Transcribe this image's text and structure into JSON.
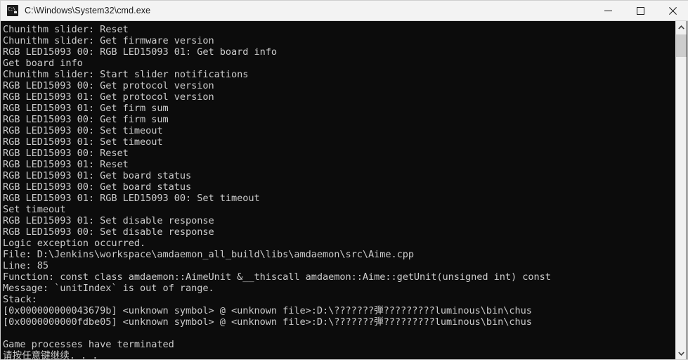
{
  "window": {
    "title": "C:\\Windows\\System32\\cmd.exe",
    "app_icon_label": "C:\\",
    "background_color": "#0c0c0c",
    "text_color": "#cccccc",
    "titlebar_color": "#f3f3f3"
  },
  "window_controls": {
    "minimize_label": "Minimize",
    "maximize_label": "Maximize",
    "close_label": "Close"
  },
  "scrollbar": {
    "up_arrow_label": "Scroll up",
    "down_arrow_label": "Scroll down",
    "thumb_label": "Scroll thumb"
  },
  "console": {
    "lines": [
      "Chunithm slider: Reset",
      "Chunithm slider: Get firmware version",
      "RGB LED15093 00: RGB LED15093 01: Get board info",
      "Get board info",
      "Chunithm slider: Start slider notifications",
      "RGB LED15093 00: Get protocol version",
      "RGB LED15093 01: Get protocol version",
      "RGB LED15093 01: Get firm sum",
      "RGB LED15093 00: Get firm sum",
      "RGB LED15093 00: Set timeout",
      "RGB LED15093 01: Set timeout",
      "RGB LED15093 00: Reset",
      "RGB LED15093 01: Reset",
      "RGB LED15093 01: Get board status",
      "RGB LED15093 00: Get board status",
      "RGB LED15093 01: RGB LED15093 00: Set timeout",
      "Set timeout",
      "RGB LED15093 01: Set disable response",
      "RGB LED15093 00: Set disable response",
      "Logic exception occurred.",
      "File: D:\\Jenkins\\workspace\\amdaemon_all_build\\libs\\amdaemon\\src\\Aime.cpp",
      "Line: 85",
      "Function: const class amdaemon::AimeUnit &__thiscall amdaemon::Aime::getUnit(unsigned int) const",
      "Message: `unitIndex` is out of range.",
      "Stack:",
      "[0x000000000043679b] <unknown symbol> @ <unknown file>:D:\\???????弾?????????luminous\\bin\\chus",
      "[0x0000000000fdbe05] <unknown symbol> @ <unknown file>:D:\\???????弾?????????luminous\\bin\\chus",
      "",
      "Game processes have terminated",
      "请按任意键继续. . ."
    ]
  }
}
